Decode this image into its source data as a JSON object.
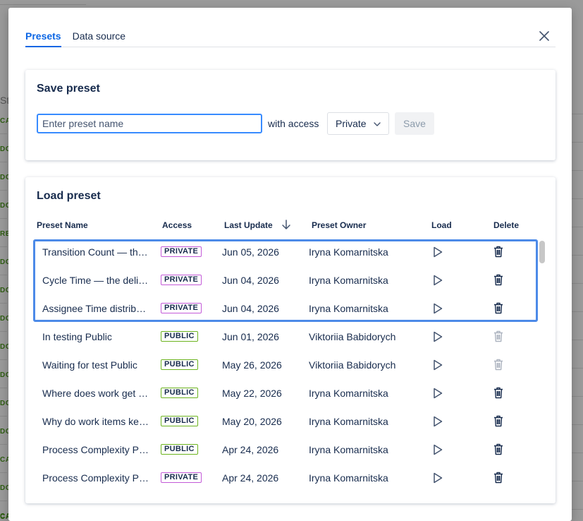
{
  "background": {
    "column_label": "St",
    "statuses": [
      "CA",
      "DO",
      "DO",
      "DO",
      "RE",
      "DO",
      "DO",
      "DO",
      "DO",
      "DO",
      "DO",
      "DO",
      "CA",
      "DO",
      "CA",
      "CANCELLED"
    ]
  },
  "tabs": [
    {
      "label": "Presets",
      "active": true
    },
    {
      "label": "Data source",
      "active": false
    }
  ],
  "save_preset": {
    "title": "Save preset",
    "input_value": "",
    "input_placeholder": "Enter preset name",
    "access_label": "with access",
    "access_value": "Private",
    "save_label": "Save"
  },
  "load_preset": {
    "title": "Load preset",
    "columns": {
      "name": "Preset Name",
      "access": "Access",
      "last_update": "Last Update",
      "owner": "Preset Owner",
      "load": "Load",
      "delete": "Delete"
    },
    "rows": [
      {
        "name": "Transition Count — the highest",
        "access": "PRIVATE",
        "date": "Jun 05, 2026",
        "owner": "Iryna Komarnitska",
        "deletable": true
      },
      {
        "name": "Cycle Time — the delivery",
        "access": "PRIVATE",
        "date": "Jun 04, 2026",
        "owner": "Iryna Komarnitska",
        "deletable": true
      },
      {
        "name": "Assignee Time distribution",
        "access": "PRIVATE",
        "date": "Jun 04, 2026",
        "owner": "Iryna Komarnitska",
        "deletable": true
      },
      {
        "name": "In testing Public",
        "access": "PUBLIC",
        "date": "Jun 01, 2026",
        "owner": "Viktoriia Babidorych",
        "deletable": false
      },
      {
        "name": "Waiting for test Public",
        "access": "PUBLIC",
        "date": "May 26, 2026",
        "owner": "Viktoriia Babidorych",
        "deletable": false
      },
      {
        "name": "Where does work get stuck",
        "access": "PUBLIC",
        "date": "May 22, 2026",
        "owner": "Iryna Komarnitska",
        "deletable": true
      },
      {
        "name": "Why do work items keep",
        "access": "PUBLIC",
        "date": "May 20, 2026",
        "owner": "Iryna Komarnitska",
        "deletable": true
      },
      {
        "name": "Process Complexity Public",
        "access": "PUBLIC",
        "date": "Apr 24, 2026",
        "owner": "Iryna Komarnitska",
        "deletable": true
      },
      {
        "name": "Process Complexity Private",
        "access": "PRIVATE",
        "date": "Apr 24, 2026",
        "owner": "Iryna Komarnitska",
        "deletable": true
      }
    ]
  },
  "colors": {
    "accent": "#0c66e4",
    "private_badge": "#c35ad8",
    "public_badge": "#6cb31f",
    "selection_outline": "#4c8ae8"
  },
  "icons": {
    "close": "close-icon",
    "dropdown": "chevron-down-icon",
    "sort": "arrow-down-icon",
    "load": "play-icon",
    "delete": "trash-icon"
  }
}
